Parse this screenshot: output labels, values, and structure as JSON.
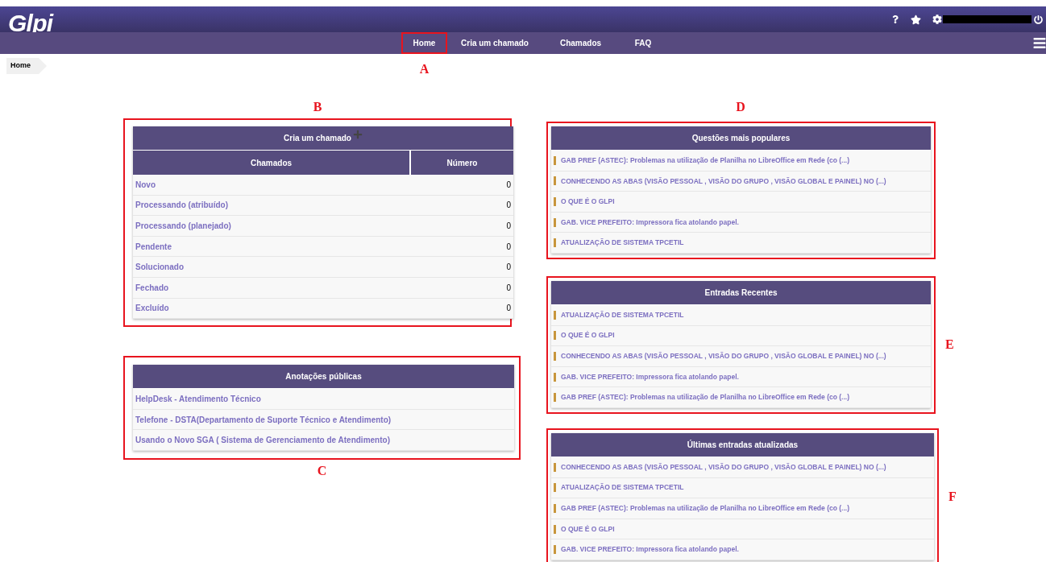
{
  "header": {
    "logo": "Glpi",
    "nav": [
      {
        "label": "Home",
        "annotation": "A"
      },
      {
        "label": "Cria um chamado"
      },
      {
        "label": "Chamados"
      },
      {
        "label": "FAQ"
      }
    ]
  },
  "breadcrumb": [
    "Home"
  ],
  "tickets_panel": {
    "annotation": "B",
    "title": "Cria um chamado",
    "columns": [
      "Chamados",
      "Número"
    ],
    "rows": [
      {
        "status": "Novo",
        "count": "0"
      },
      {
        "status": "Processando (atribuído)",
        "count": "0"
      },
      {
        "status": "Processando (planejado)",
        "count": "0"
      },
      {
        "status": "Pendente",
        "count": "0"
      },
      {
        "status": "Solucionado",
        "count": "0"
      },
      {
        "status": "Fechado",
        "count": "0"
      },
      {
        "status": "Excluído",
        "count": "0"
      }
    ]
  },
  "public_notes": {
    "annotation": "C",
    "title": "Anotações públicas",
    "items": [
      "HelpDesk - Atendimento Técnico",
      "Telefone - DSTA(Departamento de Suporte Técnico e Atendimento)",
      "Usando o Novo SGA ( Sistema de Gerenciamento de Atendimento)"
    ]
  },
  "faq_panels": [
    {
      "annotation": "D",
      "title": "Questões mais populares",
      "items": [
        "GAB PREF (ASTEC): Problemas na utilização de Planilha no LibreOffice em Rede (co (...)",
        "CONHECENDO AS ABAS (VISÃO PESSOAL , VISÃO DO GRUPO , VISÃO GLOBAL E PAINEL) NO  (...)",
        "O QUE É O GLPI",
        "GAB. VICE PREFEITO: Impressora fica atolando papel.",
        "ATUALIZAÇÃO DE SISTEMA TPCETIL"
      ]
    },
    {
      "annotation": "E",
      "title": "Entradas Recentes",
      "items": [
        "ATUALIZAÇÃO DE SISTEMA TPCETIL",
        "O QUE É O GLPI",
        "CONHECENDO AS ABAS (VISÃO PESSOAL , VISÃO DO GRUPO , VISÃO GLOBAL E PAINEL) NO  (...)",
        "GAB. VICE PREFEITO: Impressora fica atolando papel.",
        "GAB PREF (ASTEC): Problemas na utilização de Planilha no LibreOffice em Rede (co (...)"
      ]
    },
    {
      "annotation": "F",
      "title": "Últimas entradas atualizadas",
      "items": [
        "CONHECENDO AS ABAS (VISÃO PESSOAL , VISÃO DO GRUPO , VISÃO GLOBAL E PAINEL) NO  (...)",
        "ATUALIZAÇÃO DE SISTEMA TPCETIL",
        "GAB PREF (ASTEC): Problemas na utilização de Planilha no LibreOffice em Rede (co (...)",
        "O QUE É O GLPI",
        "GAB. VICE PREFEITO: Impressora fica atolando papel."
      ]
    }
  ]
}
